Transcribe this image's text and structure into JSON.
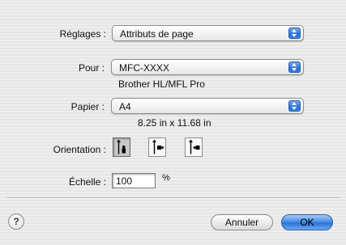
{
  "settings": {
    "label": "Réglages :",
    "value": "Attributs de page"
  },
  "format_for": {
    "label": "Pour :",
    "value": "MFC-XXXX",
    "subtext": "Brother HL/MFL Pro"
  },
  "paper": {
    "label": "Papier :",
    "value": "A4",
    "subtext": "8.25 in x 11.68 in"
  },
  "orientation": {
    "label": "Orientation :",
    "options": [
      {
        "name": "portrait",
        "selected": true
      },
      {
        "name": "landscape-left",
        "selected": false
      },
      {
        "name": "landscape-right",
        "selected": false
      }
    ]
  },
  "scale": {
    "label": "Échelle :",
    "value": "100",
    "unit": "%"
  },
  "help": {
    "glyph": "?"
  },
  "buttons": {
    "cancel": "Annuler",
    "ok": "OK"
  },
  "colors": {
    "accent": "#3e86e4",
    "background": "#ececec"
  }
}
